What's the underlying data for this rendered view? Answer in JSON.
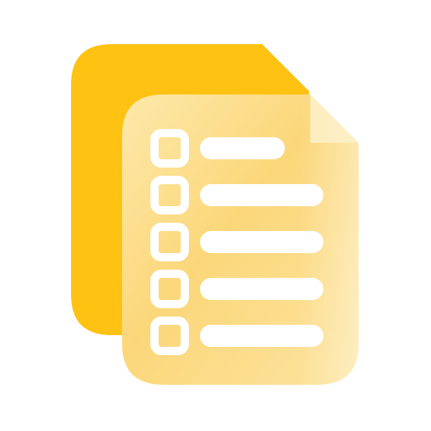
{
  "icon": {
    "name": "document-checklist-icon",
    "colors": {
      "background": "#ffffff",
      "back_sheet": "#fdc212",
      "front_sheet_light": "#fde7a4",
      "front_sheet_mid": "#fbd676",
      "front_sheet_edge": "#fcd98a",
      "marks": "#ffffff"
    },
    "checklist_rows": [
      {
        "checked": false,
        "line_length": "short"
      },
      {
        "checked": false,
        "line_length": "long"
      },
      {
        "checked": false,
        "line_length": "long"
      },
      {
        "checked": false,
        "line_length": "long"
      },
      {
        "checked": false,
        "line_length": "long"
      }
    ]
  }
}
